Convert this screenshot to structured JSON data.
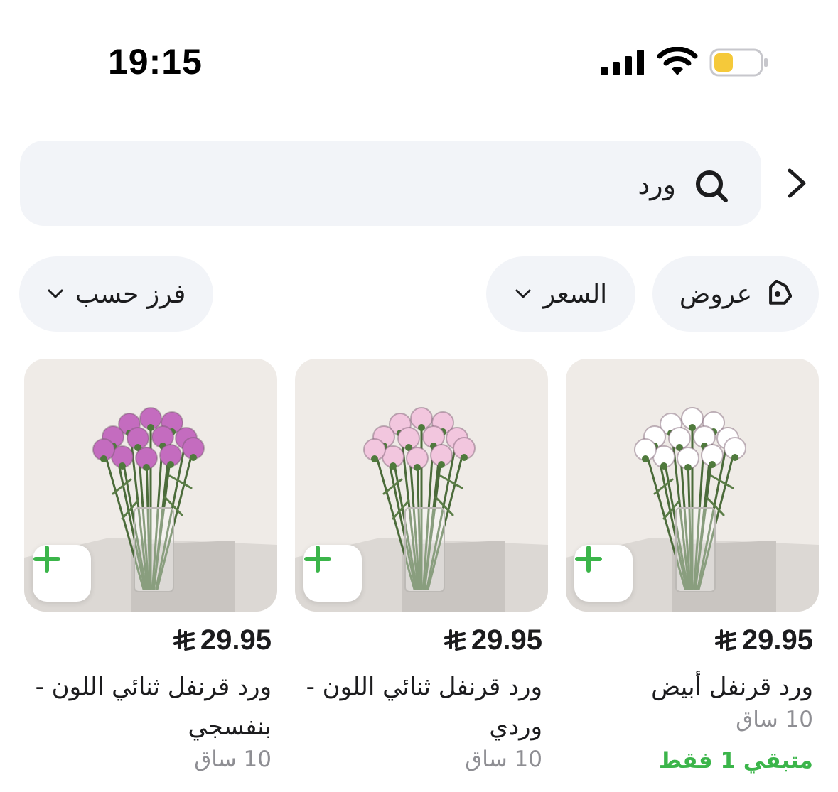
{
  "status_bar": {
    "time": "19:15",
    "battery_color": "#f5c93a"
  },
  "search": {
    "query": "ورد"
  },
  "filters": {
    "offers_label": "عروض",
    "price_label": "السعر",
    "sort_label": "فرز حسب"
  },
  "colors": {
    "accent_green": "#3bb54a",
    "chip_bg": "#f2f4f8"
  },
  "products": [
    {
      "price": "29.95",
      "currency_icon": "saudi-riyal-icon",
      "name": "ورد قرنفل أبيض",
      "stems": "10 ساق",
      "remaining": "متبقي 1 فقط",
      "flower_color": "#ffffff"
    },
    {
      "price": "29.95",
      "currency_icon": "saudi-riyal-icon",
      "name": "ورد قرنفل ثنائي اللون - وردي",
      "stems": "10 ساق",
      "flower_color": "#f2c6de"
    },
    {
      "price": "29.95",
      "currency_icon": "saudi-riyal-icon",
      "name": "ورد قرنفل ثنائي اللون - بنفسجي",
      "stems": "10 ساق",
      "flower_color": "#c46cbf"
    }
  ]
}
